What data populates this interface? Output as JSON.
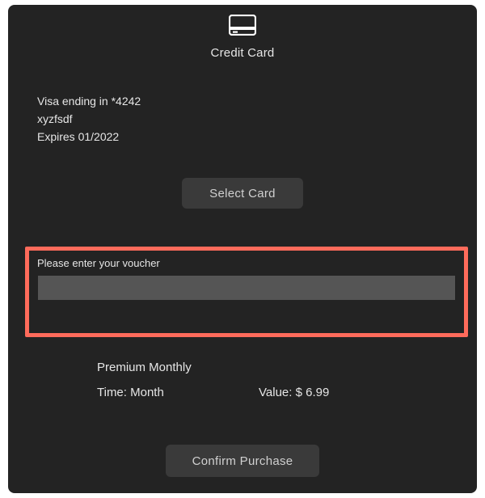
{
  "header": {
    "title": "Credit Card",
    "icon": "credit-card-icon"
  },
  "card": {
    "line1": "Visa ending in *4242",
    "name": "xyzfsdf",
    "expires": "Expires 01/2022"
  },
  "buttons": {
    "select_card": "Select Card",
    "confirm": "Confirm Purchase"
  },
  "voucher": {
    "label": "Please enter your voucher",
    "value": ""
  },
  "product": {
    "title": "Premium Monthly",
    "time_label": "Time: Month",
    "value_label": "Value: $ 6.99"
  }
}
